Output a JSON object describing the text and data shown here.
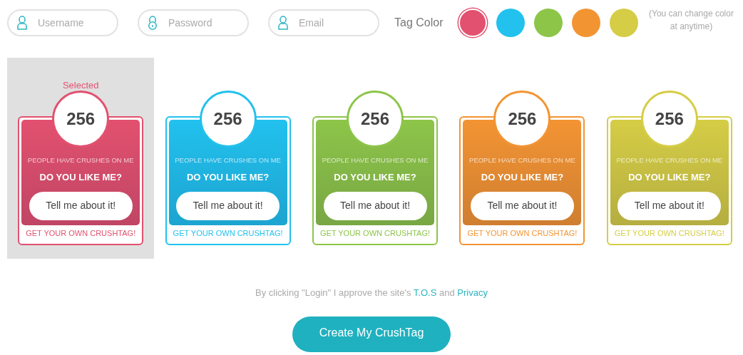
{
  "fields": [
    {
      "kind": "user",
      "placeholder": "Username"
    },
    {
      "kind": "lock",
      "placeholder": "Password"
    },
    {
      "kind": "user",
      "placeholder": "Email"
    }
  ],
  "tag_color": {
    "label": "Tag Color",
    "note": "(You can change color at anytime)",
    "swatches": [
      {
        "color": "#e2516f",
        "selected": true
      },
      {
        "color": "#22c1ee",
        "selected": false
      },
      {
        "color": "#8dc549",
        "selected": false
      },
      {
        "color": "#f39433",
        "selected": false
      },
      {
        "color": "#d5cd45",
        "selected": false
      }
    ]
  },
  "tags": [
    {
      "color": "#e2516f",
      "selected": true,
      "selected_label": "Selected",
      "count": "256",
      "subtitle": "PEOPLE HAVE CRUSHES ON ME",
      "question": "DO YOU LIKE ME?",
      "button": "Tell me about it!",
      "footer": "GET YOUR OWN CRUSHTAG!"
    },
    {
      "color": "#22c1ee",
      "selected": false,
      "count": "256",
      "subtitle": "PEOPLE HAVE CRUSHES ON ME",
      "question": "DO YOU LIKE ME?",
      "button": "Tell me about it!",
      "footer": "GET YOUR OWN CRUSHTAG!"
    },
    {
      "color": "#8dc549",
      "selected": false,
      "count": "256",
      "subtitle": "PEOPLE HAVE CRUSHES ON ME",
      "question": "DO YOU LIKE ME?",
      "button": "Tell me about it!",
      "footer": "GET YOUR OWN CRUSHTAG!"
    },
    {
      "color": "#f39433",
      "selected": false,
      "count": "256",
      "subtitle": "PEOPLE HAVE CRUSHES ON ME",
      "question": "DO YOU LIKE ME?",
      "button": "Tell me about it!",
      "footer": "GET YOUR OWN CRUSHTAG!"
    },
    {
      "color": "#d5cd45",
      "selected": false,
      "count": "256",
      "subtitle": "PEOPLE HAVE CRUSHES ON ME",
      "question": "DO YOU LIKE ME?",
      "button": "Tell me about it!",
      "footer": "GET YOUR OWN CRUSHTAG!"
    }
  ],
  "terms": {
    "text_before": "By clicking \"Login\" I approve the site's",
    "tos_link": "T.O.S",
    "text_middle": "and",
    "privacy_link": "Privacy"
  },
  "submit_button": "Create My CrushTag"
}
